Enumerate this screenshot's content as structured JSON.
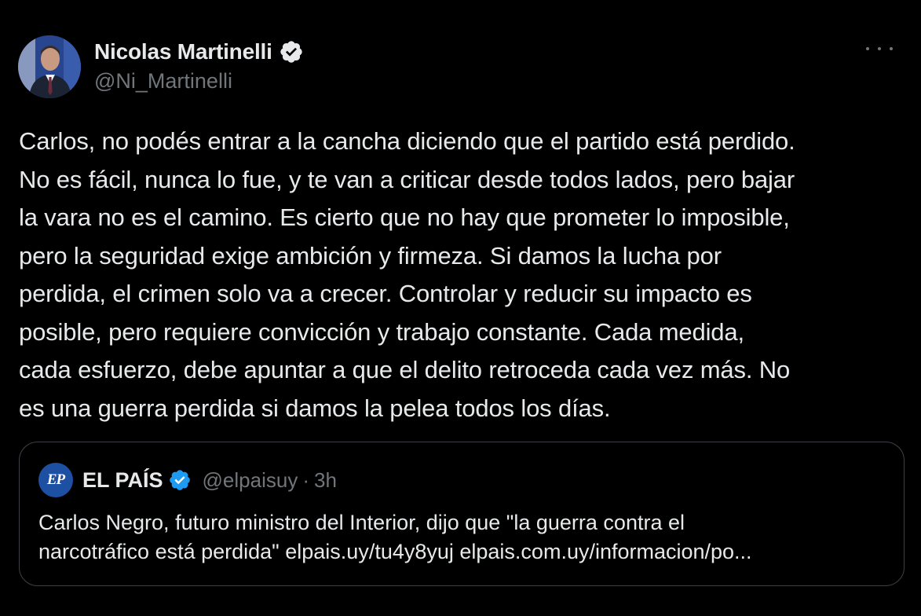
{
  "tweet": {
    "author": {
      "display_name": "Nicolas Martinelli",
      "handle": "@Ni_Martinelli",
      "verified": true,
      "avatar": "avatar-photo"
    },
    "more_icon": "more-options-icon",
    "text": "Carlos, no podés entrar a la cancha diciendo que el partido está perdido.\nNo es fácil, nunca lo fue, y te van a criticar desde todos lados, pero bajar\nla vara no es el camino. Es cierto que no hay que prometer lo imposible,\npero la seguridad exige ambición y firmeza. Si damos la lucha por\nperdida, el crimen solo va a crecer. Controlar y reducir su impacto es\nposible, pero requiere convicción y trabajo constante. Cada medida,\ncada esfuerzo, debe apuntar a que el delito retroceda cada vez más. No\nes una guerra perdida si damos la pelea todos los días."
  },
  "quoted_tweet": {
    "logo_text": "EP",
    "display_name": "EL PAÍS",
    "verified": true,
    "handle": "@elpaisuy",
    "separator": "·",
    "time": "3h",
    "text": "Carlos Negro, futuro ministro del Interior, dijo que \"la guerra contra el\nnarcotráfico está perdida\" elpais.uy/tu4y8yuj elpais.com.uy/informacion/po..."
  },
  "colors": {
    "background": "#000000",
    "text_primary": "#e7e9ea",
    "text_secondary": "#71767b",
    "verified_blue": "#1d9bf0",
    "border": "#3d4146"
  }
}
